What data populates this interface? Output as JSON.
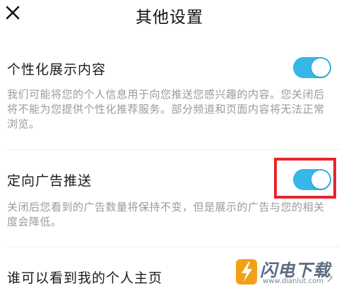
{
  "header": {
    "title": "其他设置",
    "close_icon": "close-icon"
  },
  "settings": [
    {
      "label": "个性化展示内容",
      "description": "我们可能将您的个人信息用于向您推送您感兴趣的内容。您关闭后将不能为您提供个性化推荐服务。部分频道和页面内容将无法正常浏览。",
      "enabled": true
    },
    {
      "label": "定向广告推送",
      "description": "关闭后您看到的广告数量将保持不变，但是展示的广告与您的相关度会降低。",
      "enabled": true
    }
  ],
  "profile_visibility": {
    "label": "谁可以看到我的个人主页",
    "chevron_icon": "chevron-right-icon"
  },
  "watermark": {
    "text": "闪电下载",
    "url": "www.dianlut.com"
  },
  "colors": {
    "toggle_on": "#35b7e8",
    "highlight": "#e8262a"
  }
}
